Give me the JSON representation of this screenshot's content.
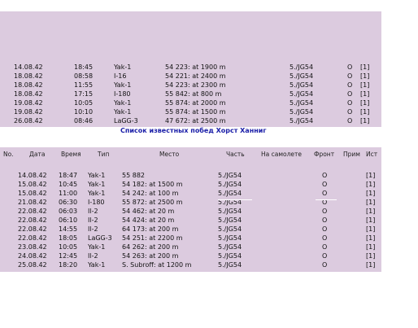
{
  "top_table": {
    "rows": [
      {
        "date": "14.08.42",
        "time": "18:45",
        "type": "Yak-1",
        "place": "54 223: at 1900 m",
        "unit": "5./JG54",
        "front": "O",
        "src": "[1]"
      },
      {
        "date": "18.08.42",
        "time": "08:58",
        "type": "I-16",
        "place": "54 221: at 2400 m",
        "unit": "5./JG54",
        "front": "O",
        "src": "[1]"
      },
      {
        "date": "18.08.42",
        "time": "11:55",
        "type": "Yak-1",
        "place": "54 223: at 2300 m",
        "unit": "5./JG54",
        "front": "O",
        "src": "[1]"
      },
      {
        "date": "18.08.42",
        "time": "17:15",
        "type": "I-180",
        "place": "55 842: at 800 m",
        "unit": "5./JG54",
        "front": "O",
        "src": "[1]"
      },
      {
        "date": "19.08.42",
        "time": "10:05",
        "type": "Yak-1",
        "place": "55 874: at 2000 m",
        "unit": "5./JG54",
        "front": "O",
        "src": "[1]"
      },
      {
        "date": "19.08.42",
        "time": "10:10",
        "type": "Yak-1",
        "place": "55 874: at 1500 m",
        "unit": "5./JG54",
        "front": "O",
        "src": "[1]"
      },
      {
        "date": "26.08.42",
        "time": "08:46",
        "type": "LaGG-3",
        "place": "47 672: at 2500 m",
        "unit": "5./JG54",
        "front": "O",
        "src": "[1]"
      }
    ]
  },
  "caption": "Список известных побед Хорст Ханниг",
  "bottom_table": {
    "headers": {
      "no": "No.",
      "date": "Дата",
      "time": "Время",
      "type": "Тип",
      "place": "Место",
      "unit": "Часть",
      "aircraft": "На самолете",
      "front": "Фронт",
      "note": "Прим",
      "src": "Ист"
    },
    "rows": [
      {
        "date": "14.08.42",
        "time": "18:47",
        "type": "Yak-1",
        "place": "55 882",
        "unit": "5./JG54",
        "front": "O",
        "src": "[1]"
      },
      {
        "date": "15.08.42",
        "time": "10:45",
        "type": "Yak-1",
        "place": "54 182: at 1500 m",
        "unit": "5./JG54",
        "front": "O",
        "src": "[1]"
      },
      {
        "date": "15.08.42",
        "time": "11:00",
        "type": "Yak-1",
        "place": "54 242: at 100 m",
        "unit": "5./JG54",
        "front": "O",
        "src": "[1]"
      },
      {
        "date": "21.08.42",
        "time": "06:30",
        "type": "I-180",
        "place": "55 872: at 2500 m",
        "unit": "5./JG54",
        "front": "O",
        "src": "[1]"
      },
      {
        "date": "22.08.42",
        "time": "06:03",
        "type": "Il-2",
        "place": "54 462: at 20 m",
        "unit": "5./JG54",
        "front": "O",
        "src": "[1]"
      },
      {
        "date": "22.08.42",
        "time": "06:10",
        "type": "Il-2",
        "place": "54 424: at 20 m",
        "unit": "5./JG54",
        "front": "O",
        "src": "[1]"
      },
      {
        "date": "22.08.42",
        "time": "14:55",
        "type": "Il-2",
        "place": "64 173: at 200 m",
        "unit": "5./JG54",
        "front": "O",
        "src": "[1]"
      },
      {
        "date": "22.08.42",
        "time": "18:05",
        "type": "LaGG-3",
        "place": "54 251: at 2200 m",
        "unit": "5./JG54",
        "front": "O",
        "src": "[1]"
      },
      {
        "date": "23.08.42",
        "time": "10:05",
        "type": "Yak-1",
        "place": "64 262: at 200 m",
        "unit": "5./JG54",
        "front": "O",
        "src": "[1]"
      },
      {
        "date": "24.08.42",
        "time": "12:45",
        "type": "Il-2",
        "place": "54 263: at 200 m",
        "unit": "5./JG54",
        "front": "O",
        "src": "[1]"
      },
      {
        "date": "25.08.42",
        "time": "18:20",
        "type": "Yak-1",
        "place": "S. Subroff: at 1200 m",
        "unit": "5./JG54",
        "front": "O",
        "src": "[1]"
      }
    ]
  },
  "colors": {
    "band": "#dccbdf",
    "caption": "#1a1ea8",
    "page": "#ffffff"
  }
}
